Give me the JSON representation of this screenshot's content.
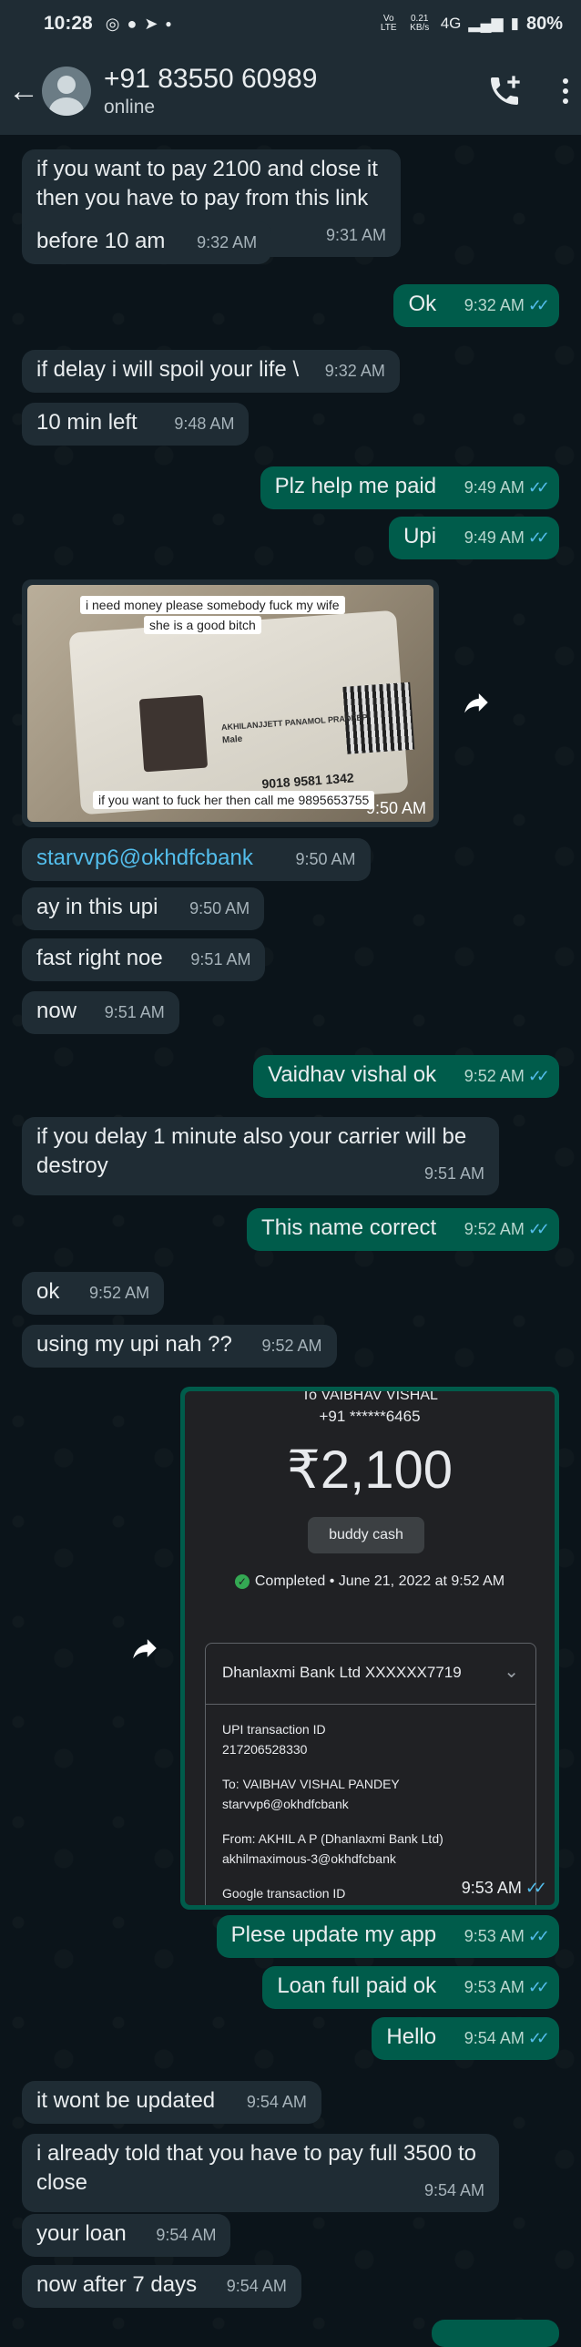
{
  "status_bar": {
    "time": "10:28",
    "volte": "Vo LTE",
    "speed": "0.21 KB/s",
    "network": "4G",
    "battery": "80%"
  },
  "header": {
    "contact_name": "+91 83550 60989",
    "contact_status": "online"
  },
  "messages": [
    {
      "dir": "in",
      "text": "if you want to pay 2100 and close it then you have to pay from this link",
      "time": "9:31 AM"
    },
    {
      "dir": "in",
      "text": "before 10 am",
      "time": "9:32 AM"
    },
    {
      "dir": "out",
      "text": "Ok",
      "time": "9:32 AM"
    },
    {
      "dir": "in",
      "text": "if delay i will spoil your life \\",
      "time": "9:32 AM"
    },
    {
      "dir": "in",
      "text": "10 min left",
      "time": "9:48 AM"
    },
    {
      "dir": "out",
      "text": "Plz help me paid",
      "time": "9:49 AM"
    },
    {
      "dir": "out",
      "text": "Upi",
      "time": "9:49 AM"
    },
    {
      "dir": "in",
      "text": "starvvp6@okhdfcbank",
      "time": "9:50 AM"
    },
    {
      "dir": "in",
      "text": "ay in this upi",
      "time": "9:50 AM"
    },
    {
      "dir": "in",
      "text": "fast right noe",
      "time": "9:51 AM"
    },
    {
      "dir": "in",
      "text": "now",
      "time": "9:51 AM"
    },
    {
      "dir": "out",
      "text": "Vaidhav vishal ok",
      "time": "9:52 AM"
    },
    {
      "dir": "in",
      "text": "if you delay 1 minute also your carrier will be destroy",
      "time": "9:51 AM"
    },
    {
      "dir": "out",
      "text": "This name correct",
      "time": "9:52 AM"
    },
    {
      "dir": "in",
      "text": "ok",
      "time": "9:52 AM"
    },
    {
      "dir": "in",
      "text": "using my upi nah ??",
      "time": "9:52 AM"
    },
    {
      "dir": "out",
      "text": "Plese update my app",
      "time": "9:53 AM"
    },
    {
      "dir": "out",
      "text": "Loan full paid ok",
      "time": "9:53 AM"
    },
    {
      "dir": "out",
      "text": "Hello",
      "time": "9:54 AM"
    },
    {
      "dir": "in",
      "text": "it wont be updated",
      "time": "9:54 AM"
    },
    {
      "dir": "in",
      "text": "i already told that you have to pay full 3500 to close",
      "time": "9:54 AM"
    },
    {
      "dir": "in",
      "text": "your loan",
      "time": "9:54 AM"
    },
    {
      "dir": "in",
      "text": "now after 7 days",
      "time": "9:54 AM"
    }
  ],
  "image_message": {
    "caption_top_1": "i need money please somebody fuck my wife",
    "caption_top_2": "she is a good bitch",
    "caption_bottom": "if you want to fuck her then call me 9895653755",
    "card_name": "AKHILANJJETT PANAMOL PRADEEP",
    "card_gender": "Male",
    "card_number": "9018 9581 1342",
    "time": "9:50 AM"
  },
  "payment_message": {
    "to": "To VAIBHAV VISHAL",
    "phone": "+91 ******6465",
    "amount": "₹2,100",
    "note": "buddy cash",
    "status": "Completed • June 21, 2022 at 9:52 AM",
    "bank": "Dhanlaxmi Bank Ltd XXXXXX7719",
    "upi_label": "UPI transaction ID",
    "upi_id": "217206528330",
    "to_label": "To: VAIBHAV VISHAL PANDEY",
    "to_upi": "starvvp6@okhdfcbank",
    "from_label": "From: AKHIL A P (Dhanlaxmi Bank Ltd)",
    "from_upi": "akhilmaximous-3@okhdfcbank",
    "google_label": "Google transaction ID",
    "time": "9:53 AM"
  },
  "icons": {
    "back": "arrow-left-icon",
    "call": "add-call-icon",
    "more": "more-vert-icon",
    "share": "forward-icon",
    "ticks": "double-check-icon"
  },
  "colors": {
    "background": "#0b141a",
    "header": "#1f2c34",
    "incoming_bubble": "#1f2c34",
    "outgoing_bubble": "#005c4b",
    "read_ticks": "#53bdeb"
  }
}
